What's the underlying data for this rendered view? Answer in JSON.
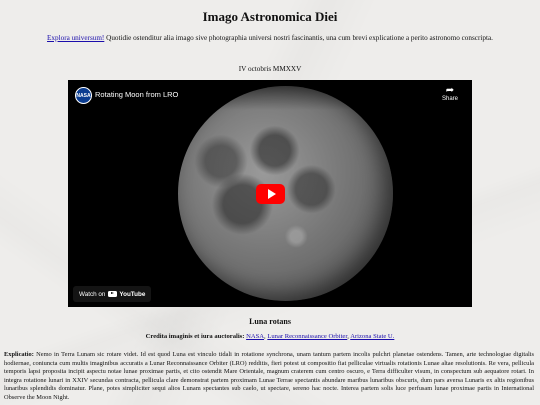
{
  "page": {
    "title": "Imago Astronomica Diei",
    "intro_link": "Explora universum!",
    "intro_text": " Quotidie ostenditur alia imago sive photographia universi nostri fascinantis, una cum brevi explicatione a perito astronomo conscripta.",
    "date": "IV octobris MMXXV"
  },
  "video": {
    "logo_text": "NASA",
    "title": "Rotating Moon from LRO",
    "share_label": "Share",
    "watch_on_label": "Watch on",
    "youtube_label": "YouTube"
  },
  "caption": {
    "title": "Luna rotans",
    "credits_label": "Credita imaginis et iura auctoralis:",
    "credits_links": [
      "NASA",
      "Lunar Reconnaissance Orbiter",
      "Arizona State U."
    ]
  },
  "explanation": {
    "label": "Explicatio:",
    "text": " Nemo in Terra Lunam sic rotare videt. Id est quod Luna est vinculo tidali in rotatione synchrona, unam tantum partem incolis pulchri planetae ostendens. Tamen, arte technologiae digitalis hodiernae, coniuncta cum multis imaginibus accuratis a Lunar Reconnaissance Orbiter (LRO) redditis, fieri potest ut compositio fiat pelliculae virtualis rotationis Lunae altae resolutionis. Re vera, pellicula temporis lapsi proposita incipit aspectu notae lunae proximae partis, et cito ostendit Mare Orientale, magnum craterem cum centro oscuro, e Terra difficulter visum, in conspectum sub aequatore rotari. In integra rotatione lunari in XXIV secundas contracta, pellicula clare demonstrat partem proximam Lunae Terrae spectantis abundare maribus lunaribus obscuris, dum pars aversa Lunaris ex altis regionibus lunaribus splendidis dominatur. Plane, potes simpliciter sequi alios Lunam spectantes sub caelo, ut spectare, sereno hac nocte. Interea partem solis luce perfusam lunae proximae partis in International Observe the Moon Night."
  }
}
